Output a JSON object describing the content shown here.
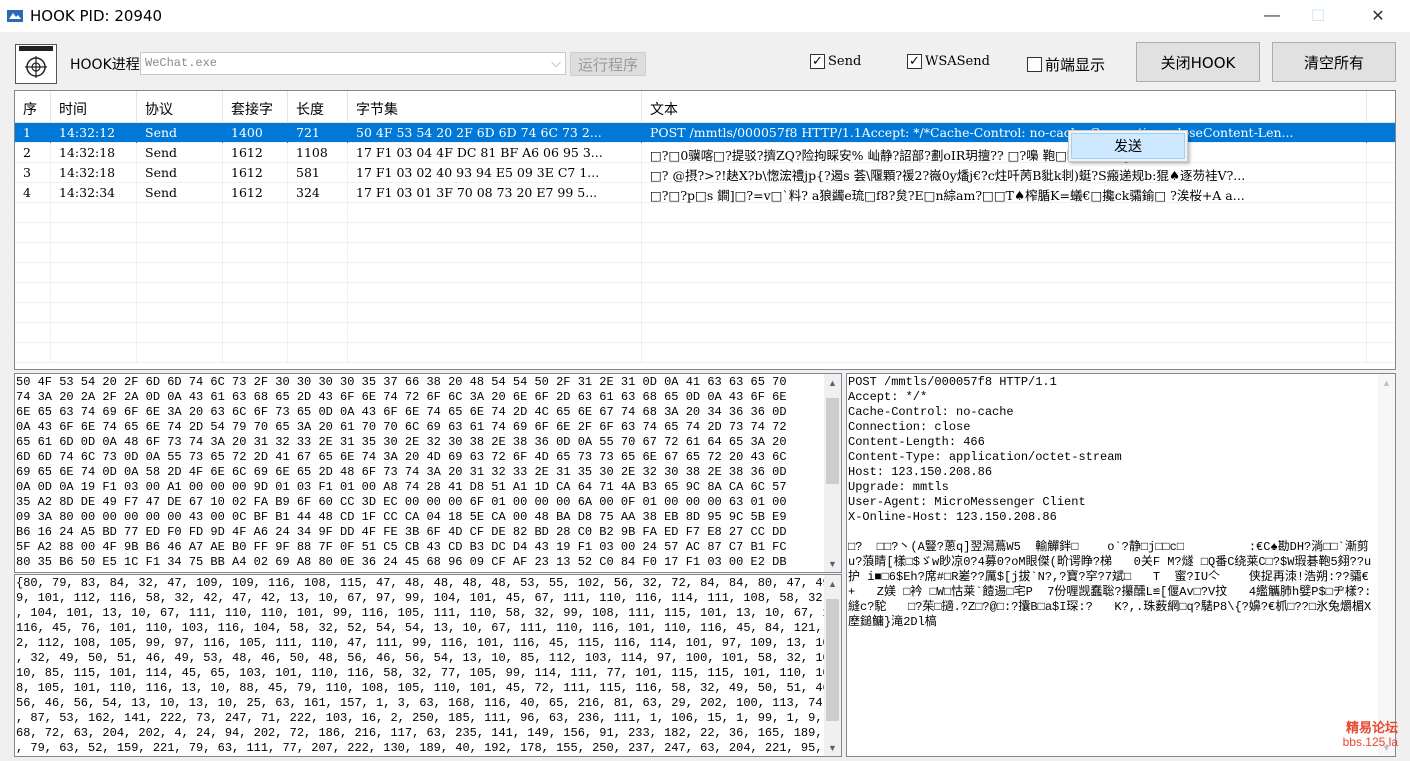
{
  "window": {
    "title": "HOOK PID:  20940",
    "min_glyph": "—",
    "max_glyph": "☐",
    "close_glyph": "✕"
  },
  "toolbar": {
    "process_label": "HOOK进程",
    "process_value": "WeChat.exe",
    "run_label": "运行程序",
    "send_label": "Send",
    "send_checked": true,
    "wsasend_label": "WSASend",
    "wsasend_checked": true,
    "front_label": "前端显示",
    "front_checked": false,
    "close_hook_label": "关闭HOOK",
    "clear_all_label": "清空所有",
    "check_mark": "✓"
  },
  "table": {
    "columns": [
      "序",
      "时间",
      "协议",
      "套接字",
      "长度",
      "字节集",
      "文本"
    ],
    "rows": [
      {
        "seq": "1",
        "time": "14:32:12",
        "proto": "Send",
        "sock": "1400",
        "len": "721",
        "bytes": "50 4F 53 54 20 2F 6D 6D 74 6C 73 2...",
        "text": "POST /mmtls/000057f8 HTTP/1.1Accept: */*Cache-Control: no-cache Connection: closeContent-Len...",
        "selected": true
      },
      {
        "seq": "2",
        "time": "14:32:18",
        "proto": "Send",
        "sock": "1612",
        "len": "1108",
        "bytes": "17 F1 03 04 4F DC 81 BF A6 06 95 3...",
        "text": "□?□0骥喀□?提驳?擠ZQ?险拘睬安% 屾静?詔部?劃oIR玥擅??  □?嘄   鞄□睅h??豬侶j灿...",
        "selected": false
      },
      {
        "seq": "3",
        "time": "14:32:18",
        "proto": "Send",
        "sock": "1612",
        "len": "581",
        "bytes": "17 F1 03 02 40 93 94 E5 09 3E C7 1...",
        "text": "□? @摂?>?!赽X?b\\愡浤禮jp{?遏s 荟\\隁顆?禐2?嶶0y燔j€?c炷吀苪B豼k剕)蜓?S瘢递规b:猑♠逐芴袿V?...",
        "selected": false
      },
      {
        "seq": "4",
        "time": "14:32:34",
        "proto": "Send",
        "sock": "1612",
        "len": "324",
        "bytes": "17 F1 03 01 3F 70 08 73 20 E7 99 5...",
        "text": "□?□?p□s 鐧]□?=v□`料?  a狼蠲e琉□f8?炱?E□n綜am?□□T♠榨腯K=蟻€□攙ck骦鍮□  ?涘桜+A a...",
        "selected": false
      }
    ],
    "empty_rows": 8
  },
  "context_menu": {
    "item_label": "发送"
  },
  "hex_panel": {
    "lines": [
      "50 4F 53 54 20 2F 6D 6D 74 6C 73 2F 30 30 30 30 35 37 66 38 20 48 54 54 50 2F 31 2E 31 0D 0A 41 63 63 65 70",
      "74 3A 20 2A 2F 2A 0D 0A 43 61 63 68 65 2D 43 6F 6E 74 72 6F 6C 3A 20 6E 6F 2D 63 61 63 68 65 0D 0A 43 6F 6E",
      "6E 65 63 74 69 6F 6E 3A 20 63 6C 6F 73 65 0D 0A 43 6F 6E 74 65 6E 74 2D 4C 65 6E 67 74 68 3A 20 34 36 36 0D",
      "0A 43 6F 6E 74 65 6E 74 2D 54 79 70 65 3A 20 61 70 70 6C 69 63 61 74 69 6F 6E 2F 6F 63 74 65 74 2D 73 74 72",
      "65 61 6D 0D 0A 48 6F 73 74 3A 20 31 32 33 2E 31 35 30 2E 32 30 38 2E 38 36 0D 0A 55 70 67 72 61 64 65 3A 20",
      "6D 6D 74 6C 73 0D 0A 55 73 65 72 2D 41 67 65 6E 74 3A 20 4D 69 63 72 6F 4D 65 73 73 65 6E 67 65 72 20 43 6C",
      "69 65 6E 74 0D 0A 58 2D 4F 6E 6C 69 6E 65 2D 48 6F 73 74 3A 20 31 32 33 2E 31 35 30 2E 32 30 38 2E 38 36 0D",
      "0A 0D 0A 19 F1 03 00 A1 00 00 00 9D 01 03 F1 01 00 A8 74 28 41 D8 51 A1 1D CA 64 71 4A B3 65 9C 8A CA 6C 57",
      "35 A2 8D DE 49 F7 47 DE 67 10 02 FA B9 6F 60 CC 3D EC 00 00 00 6F 01 00 00 00 6A 00 0F 01 00 00 00 63 01 00",
      "09 3A 80 00 00 00 00 00 43 00 0C BF B1 44 48 CD 1F CC CA 04 18 5E CA 00 48 BA D8 75 AA 38 EB 8D 95 9C 5B E9",
      "B6 16 24 A5 BD 77 ED F0 FD 9D 4F A6 24 34 9F DD 4F FE 3B 6F 4D CF DE 82 BD 28 C0 B2 9B FA ED F7 E8 27 CC DD",
      "5F A2 88 00 4F 9B B6 46 A7 AE B0 FF 9F 88 7F 0F 51 C5 CB 43 CD B3 DC D4 43 19 F1 03 00 24 57 AC 87 C7 B1 FC",
      "80 35 B6 50 E5 1C F1 34 75 BB A4 02 69 A8 80 0E 36 24 45 68 96 09 CF AF 23 13 52 C0 84 F0 17 F1 03 00 E2 DB"
    ]
  },
  "dec_panel": {
    "lines": [
      "{80, 79, 83, 84, 32, 47, 109, 109, 116, 108, 115, 47, 48, 48, 48, 48, 53, 55, 102, 56, 32, 72, 84, 84, 80, 47, 49, 46, 49, 13, 10, 65, 99, 9",
      "9, 101, 112, 116, 58, 32, 42, 47, 42, 13, 10, 67, 97, 99, 104, 101, 45, 67, 111, 110, 116, 114, 111, 108, 58, 32, 110, 111, 45, 99, 97, 99",
      ", 104, 101, 13, 10, 67, 111, 110, 110, 101, 99, 116, 105, 111, 110, 58, 32, 99, 108, 111, 115, 101, 13, 10, 67, 111, 110, 116, 101, 110,",
      "116, 45, 76, 101, 110, 103, 116, 104, 58, 32, 52, 54, 54, 13, 10, 67, 111, 110, 116, 101, 110, 116, 45, 84, 121, 112, 101, 58, 32, 97, 11",
      "2, 112, 108, 105, 99, 97, 116, 105, 111, 110, 47, 111, 99, 116, 101, 116, 45, 115, 116, 114, 101, 97, 109, 13, 10, 72, 111, 115, 116, 58",
      ", 32, 49, 50, 51, 46, 49, 53, 48, 46, 50, 48, 56, 46, 56, 54, 13, 10, 85, 112, 103, 114, 97, 100, 101, 58, 32, 109, 109, 116, 108, 115, 13,",
      "10, 85, 115, 101, 114, 45, 65, 103, 101, 110, 116, 58, 32, 77, 105, 99, 114, 111, 77, 101, 115, 115, 101, 110, 103, 101, 114, 32, 67, 10",
      "8, 105, 101, 110, 116, 13, 10, 88, 45, 79, 110, 108, 105, 110, 101, 45, 72, 111, 115, 116, 58, 32, 49, 50, 51, 46, 49, 53, 48, 46, 50, 48,",
      "56, 46, 56, 54, 13, 10, 13, 10, 25, 63, 161, 157, 1, 3, 63, 168, 116, 40, 65, 216, 81, 63, 29, 202, 100, 113, 74, 179, 101, 156, 138, 202, 108",
      ", 87, 53, 162, 141, 222, 73, 247, 71, 222, 103, 16, 2, 250, 185, 111, 96, 63, 236, 111, 1, 106, 15, 1, 99, 1, 9, 58, 128, 67, 12, 191, 177,",
      "68, 72, 63, 204, 202, 4, 24, 94, 202, 72, 186, 216, 117, 63, 235, 141, 149, 156, 91, 233, 182, 22, 36, 165, 189, 119, 237, 240, 253, 157",
      ", 79, 63, 52, 159, 221, 79, 63, 111, 77, 207, 222, 130, 189, 40, 192, 178, 155, 250, 237, 247, 63, 204, 221, 95, 162, 136, 79, 155, 182,"
    ]
  },
  "text_panel": {
    "lines": [
      "POST /mmtls/000057f8 HTTP/1.1",
      "Accept: */*",
      "Cache-Control: no-cache",
      "Connection: close",
      "Content-Length: 466",
      "Content-Type: application/octet-stream",
      "Host: 123.150.208.86",
      "Upgrade: mmtls",
      "User-Agent: MicroMessenger Client",
      "X-Online-Host: 123.150.208.86",
      "",
      "□?  □□?丶(A豎?蔥q]翌澙蔦W5  輸觶鉡□    o`?静□j□□c□         :€C♠勘DH?淌□□`漸剪u?蒗睛[樣□$ゞw眇凉0?4募0?oM眼傑(畍谔睁?梯   0关F M?燧 □Q番C绕莱C□?$W瑕碁鞄5翗??u护 i■□6$Eh?席#□R嵳??厲$[j拔`N?,?寶?穻?7斌□   T  蜜?IU亽    侠捉再洓!浩朔:??骦€ +   Z媄 □衿 □W□怙莱`饐逷□宅P  7份喱觊蠢聡?攥醺L≌[偃Av□?V抆   4繿觿肺h嬖P$□ヂ樣?:縫c?駝   □?茱□擿.?Z□?@□:?攮B□a$I琛:?   K?,.珠薮網□q?騞P8\\{?嬶?€枛□??□氷兔爝楣X塺鎚鳙}滝2Dl槁"
    ]
  },
  "watermark": {
    "line1": "精易论坛",
    "line2": "bbs.125.la"
  }
}
